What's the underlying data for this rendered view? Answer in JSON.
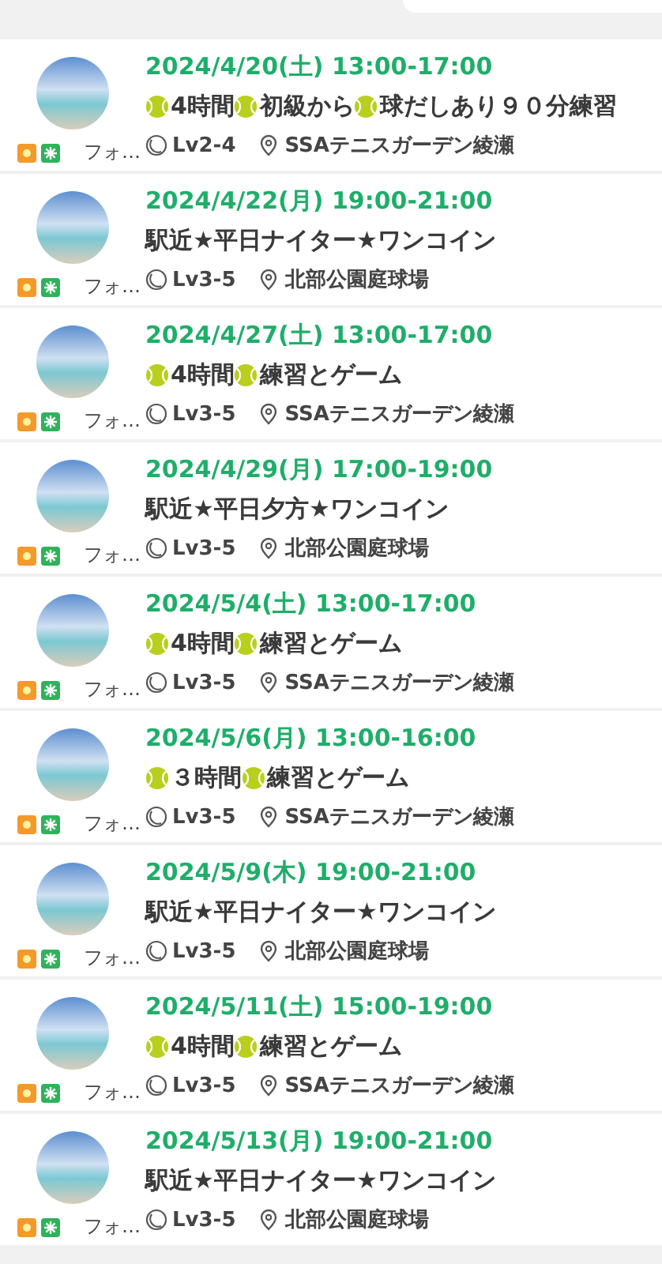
{
  "events": [
    {
      "organizer": "フォ…",
      "date": "2024/4/20(土) 13:00-17:00",
      "title_parts": [
        {
          "kind": "ball"
        },
        {
          "kind": "text",
          "text": "4時間"
        },
        {
          "kind": "ball"
        },
        {
          "kind": "text",
          "text": " 初級から"
        },
        {
          "kind": "ball"
        },
        {
          "kind": "text",
          "text": " 球だしあり９０分練習"
        }
      ],
      "level": "Lv2-4",
      "place": "SSAテニスガーデン綾瀬"
    },
    {
      "organizer": "フォ…",
      "date": "2024/4/22(月) 19:00-21:00",
      "title_parts": [
        {
          "kind": "text",
          "text": "駅近★平日ナイター★ワンコイン"
        }
      ],
      "level": "Lv3-5",
      "place": "北部公園庭球場"
    },
    {
      "organizer": "フォ…",
      "date": "2024/4/27(土) 13:00-17:00",
      "title_parts": [
        {
          "kind": "ball"
        },
        {
          "kind": "text",
          "text": "4時間"
        },
        {
          "kind": "ball"
        },
        {
          "kind": "text",
          "text": " 練習とゲーム"
        }
      ],
      "level": "Lv3-5",
      "place": "SSAテニスガーデン綾瀬"
    },
    {
      "organizer": "フォ…",
      "date": "2024/4/29(月) 17:00-19:00",
      "title_parts": [
        {
          "kind": "text",
          "text": "駅近★平日夕方★ワンコイン"
        }
      ],
      "level": "Lv3-5",
      "place": "北部公園庭球場"
    },
    {
      "organizer": "フォ…",
      "date": "2024/5/4(土) 13:00-17:00",
      "title_parts": [
        {
          "kind": "ball"
        },
        {
          "kind": "text",
          "text": "4時間"
        },
        {
          "kind": "ball"
        },
        {
          "kind": "text",
          "text": " 練習とゲーム"
        }
      ],
      "level": "Lv3-5",
      "place": "SSAテニスガーデン綾瀬"
    },
    {
      "organizer": "フォ…",
      "date": "2024/5/6(月) 13:00-16:00",
      "title_parts": [
        {
          "kind": "ball"
        },
        {
          "kind": "text",
          "text": " ３時間"
        },
        {
          "kind": "ball"
        },
        {
          "kind": "text",
          "text": " 練習とゲーム"
        }
      ],
      "level": "Lv3-5",
      "place": "SSAテニスガーデン綾瀬"
    },
    {
      "organizer": "フォ…",
      "date": "2024/5/9(木) 19:00-21:00",
      "title_parts": [
        {
          "kind": "text",
          "text": "駅近★平日ナイター★ワンコイン"
        }
      ],
      "level": "Lv3-5",
      "place": "北部公園庭球場"
    },
    {
      "organizer": "フォ…",
      "date": "2024/5/11(土) 15:00-19:00",
      "title_parts": [
        {
          "kind": "ball"
        },
        {
          "kind": "text",
          "text": "4時間"
        },
        {
          "kind": "ball"
        },
        {
          "kind": "text",
          "text": " 練習とゲーム"
        }
      ],
      "level": "Lv3-5",
      "place": "SSAテニスガーデン綾瀬"
    },
    {
      "organizer": "フォ…",
      "date": "2024/5/13(月) 19:00-21:00",
      "title_parts": [
        {
          "kind": "text",
          "text": "駅近★平日ナイター★ワンコイン"
        }
      ],
      "level": "Lv3-5",
      "place": "北部公園庭球場"
    }
  ]
}
